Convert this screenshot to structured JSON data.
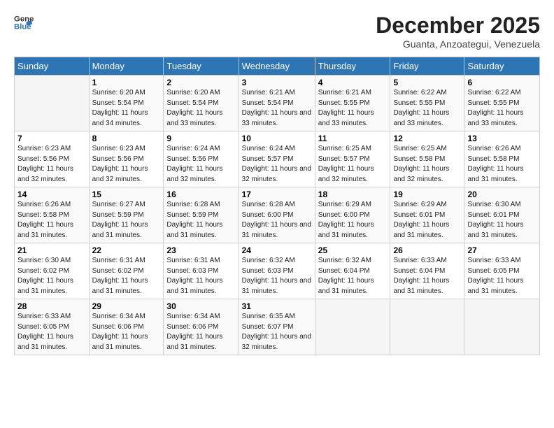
{
  "header": {
    "logo_text1": "General",
    "logo_text2": "Blue",
    "title": "December 2025",
    "location": "Guanta, Anzoategui, Venezuela"
  },
  "weekdays": [
    "Sunday",
    "Monday",
    "Tuesday",
    "Wednesday",
    "Thursday",
    "Friday",
    "Saturday"
  ],
  "weeks": [
    [
      {
        "day": "",
        "sunrise": "",
        "sunset": "",
        "daylight": ""
      },
      {
        "day": "1",
        "sunrise": "Sunrise: 6:20 AM",
        "sunset": "Sunset: 5:54 PM",
        "daylight": "Daylight: 11 hours and 34 minutes."
      },
      {
        "day": "2",
        "sunrise": "Sunrise: 6:20 AM",
        "sunset": "Sunset: 5:54 PM",
        "daylight": "Daylight: 11 hours and 33 minutes."
      },
      {
        "day": "3",
        "sunrise": "Sunrise: 6:21 AM",
        "sunset": "Sunset: 5:54 PM",
        "daylight": "Daylight: 11 hours and 33 minutes."
      },
      {
        "day": "4",
        "sunrise": "Sunrise: 6:21 AM",
        "sunset": "Sunset: 5:55 PM",
        "daylight": "Daylight: 11 hours and 33 minutes."
      },
      {
        "day": "5",
        "sunrise": "Sunrise: 6:22 AM",
        "sunset": "Sunset: 5:55 PM",
        "daylight": "Daylight: 11 hours and 33 minutes."
      },
      {
        "day": "6",
        "sunrise": "Sunrise: 6:22 AM",
        "sunset": "Sunset: 5:55 PM",
        "daylight": "Daylight: 11 hours and 33 minutes."
      }
    ],
    [
      {
        "day": "7",
        "sunrise": "Sunrise: 6:23 AM",
        "sunset": "Sunset: 5:56 PM",
        "daylight": "Daylight: 11 hours and 32 minutes."
      },
      {
        "day": "8",
        "sunrise": "Sunrise: 6:23 AM",
        "sunset": "Sunset: 5:56 PM",
        "daylight": "Daylight: 11 hours and 32 minutes."
      },
      {
        "day": "9",
        "sunrise": "Sunrise: 6:24 AM",
        "sunset": "Sunset: 5:56 PM",
        "daylight": "Daylight: 11 hours and 32 minutes."
      },
      {
        "day": "10",
        "sunrise": "Sunrise: 6:24 AM",
        "sunset": "Sunset: 5:57 PM",
        "daylight": "Daylight: 11 hours and 32 minutes."
      },
      {
        "day": "11",
        "sunrise": "Sunrise: 6:25 AM",
        "sunset": "Sunset: 5:57 PM",
        "daylight": "Daylight: 11 hours and 32 minutes."
      },
      {
        "day": "12",
        "sunrise": "Sunrise: 6:25 AM",
        "sunset": "Sunset: 5:58 PM",
        "daylight": "Daylight: 11 hours and 32 minutes."
      },
      {
        "day": "13",
        "sunrise": "Sunrise: 6:26 AM",
        "sunset": "Sunset: 5:58 PM",
        "daylight": "Daylight: 11 hours and 31 minutes."
      }
    ],
    [
      {
        "day": "14",
        "sunrise": "Sunrise: 6:26 AM",
        "sunset": "Sunset: 5:58 PM",
        "daylight": "Daylight: 11 hours and 31 minutes."
      },
      {
        "day": "15",
        "sunrise": "Sunrise: 6:27 AM",
        "sunset": "Sunset: 5:59 PM",
        "daylight": "Daylight: 11 hours and 31 minutes."
      },
      {
        "day": "16",
        "sunrise": "Sunrise: 6:28 AM",
        "sunset": "Sunset: 5:59 PM",
        "daylight": "Daylight: 11 hours and 31 minutes."
      },
      {
        "day": "17",
        "sunrise": "Sunrise: 6:28 AM",
        "sunset": "Sunset: 6:00 PM",
        "daylight": "Daylight: 11 hours and 31 minutes."
      },
      {
        "day": "18",
        "sunrise": "Sunrise: 6:29 AM",
        "sunset": "Sunset: 6:00 PM",
        "daylight": "Daylight: 11 hours and 31 minutes."
      },
      {
        "day": "19",
        "sunrise": "Sunrise: 6:29 AM",
        "sunset": "Sunset: 6:01 PM",
        "daylight": "Daylight: 11 hours and 31 minutes."
      },
      {
        "day": "20",
        "sunrise": "Sunrise: 6:30 AM",
        "sunset": "Sunset: 6:01 PM",
        "daylight": "Daylight: 11 hours and 31 minutes."
      }
    ],
    [
      {
        "day": "21",
        "sunrise": "Sunrise: 6:30 AM",
        "sunset": "Sunset: 6:02 PM",
        "daylight": "Daylight: 11 hours and 31 minutes."
      },
      {
        "day": "22",
        "sunrise": "Sunrise: 6:31 AM",
        "sunset": "Sunset: 6:02 PM",
        "daylight": "Daylight: 11 hours and 31 minutes."
      },
      {
        "day": "23",
        "sunrise": "Sunrise: 6:31 AM",
        "sunset": "Sunset: 6:03 PM",
        "daylight": "Daylight: 11 hours and 31 minutes."
      },
      {
        "day": "24",
        "sunrise": "Sunrise: 6:32 AM",
        "sunset": "Sunset: 6:03 PM",
        "daylight": "Daylight: 11 hours and 31 minutes."
      },
      {
        "day": "25",
        "sunrise": "Sunrise: 6:32 AM",
        "sunset": "Sunset: 6:04 PM",
        "daylight": "Daylight: 11 hours and 31 minutes."
      },
      {
        "day": "26",
        "sunrise": "Sunrise: 6:33 AM",
        "sunset": "Sunset: 6:04 PM",
        "daylight": "Daylight: 11 hours and 31 minutes."
      },
      {
        "day": "27",
        "sunrise": "Sunrise: 6:33 AM",
        "sunset": "Sunset: 6:05 PM",
        "daylight": "Daylight: 11 hours and 31 minutes."
      }
    ],
    [
      {
        "day": "28",
        "sunrise": "Sunrise: 6:33 AM",
        "sunset": "Sunset: 6:05 PM",
        "daylight": "Daylight: 11 hours and 31 minutes."
      },
      {
        "day": "29",
        "sunrise": "Sunrise: 6:34 AM",
        "sunset": "Sunset: 6:06 PM",
        "daylight": "Daylight: 11 hours and 31 minutes."
      },
      {
        "day": "30",
        "sunrise": "Sunrise: 6:34 AM",
        "sunset": "Sunset: 6:06 PM",
        "daylight": "Daylight: 11 hours and 31 minutes."
      },
      {
        "day": "31",
        "sunrise": "Sunrise: 6:35 AM",
        "sunset": "Sunset: 6:07 PM",
        "daylight": "Daylight: 11 hours and 32 minutes."
      },
      {
        "day": "",
        "sunrise": "",
        "sunset": "",
        "daylight": ""
      },
      {
        "day": "",
        "sunrise": "",
        "sunset": "",
        "daylight": ""
      },
      {
        "day": "",
        "sunrise": "",
        "sunset": "",
        "daylight": ""
      }
    ]
  ]
}
